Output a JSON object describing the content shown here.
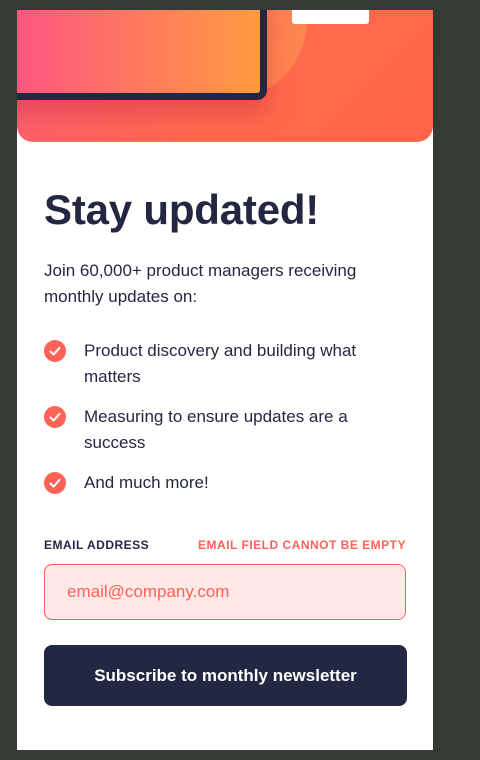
{
  "signup": {
    "title": "Stay updated!",
    "intro": "Join 60,000+ product managers receiving monthly updates on:",
    "features": [
      {
        "text": "Product discovery and building what matters",
        "icon": "check-icon"
      },
      {
        "text": "Measuring to ensure updates are a success",
        "icon": "check-icon"
      },
      {
        "text": "And much more!",
        "icon": "check-icon"
      }
    ],
    "email": {
      "label": "Email address",
      "error": "Email field cannot be empty",
      "value": "",
      "placeholder": "email@company.com"
    },
    "submit_label": "Subscribe to monthly newsletter"
  },
  "colors": {
    "accent": "#ff6257",
    "dark": "#242742",
    "input_error_bg": "#ffe8e6",
    "page_bg": "#363a34"
  }
}
